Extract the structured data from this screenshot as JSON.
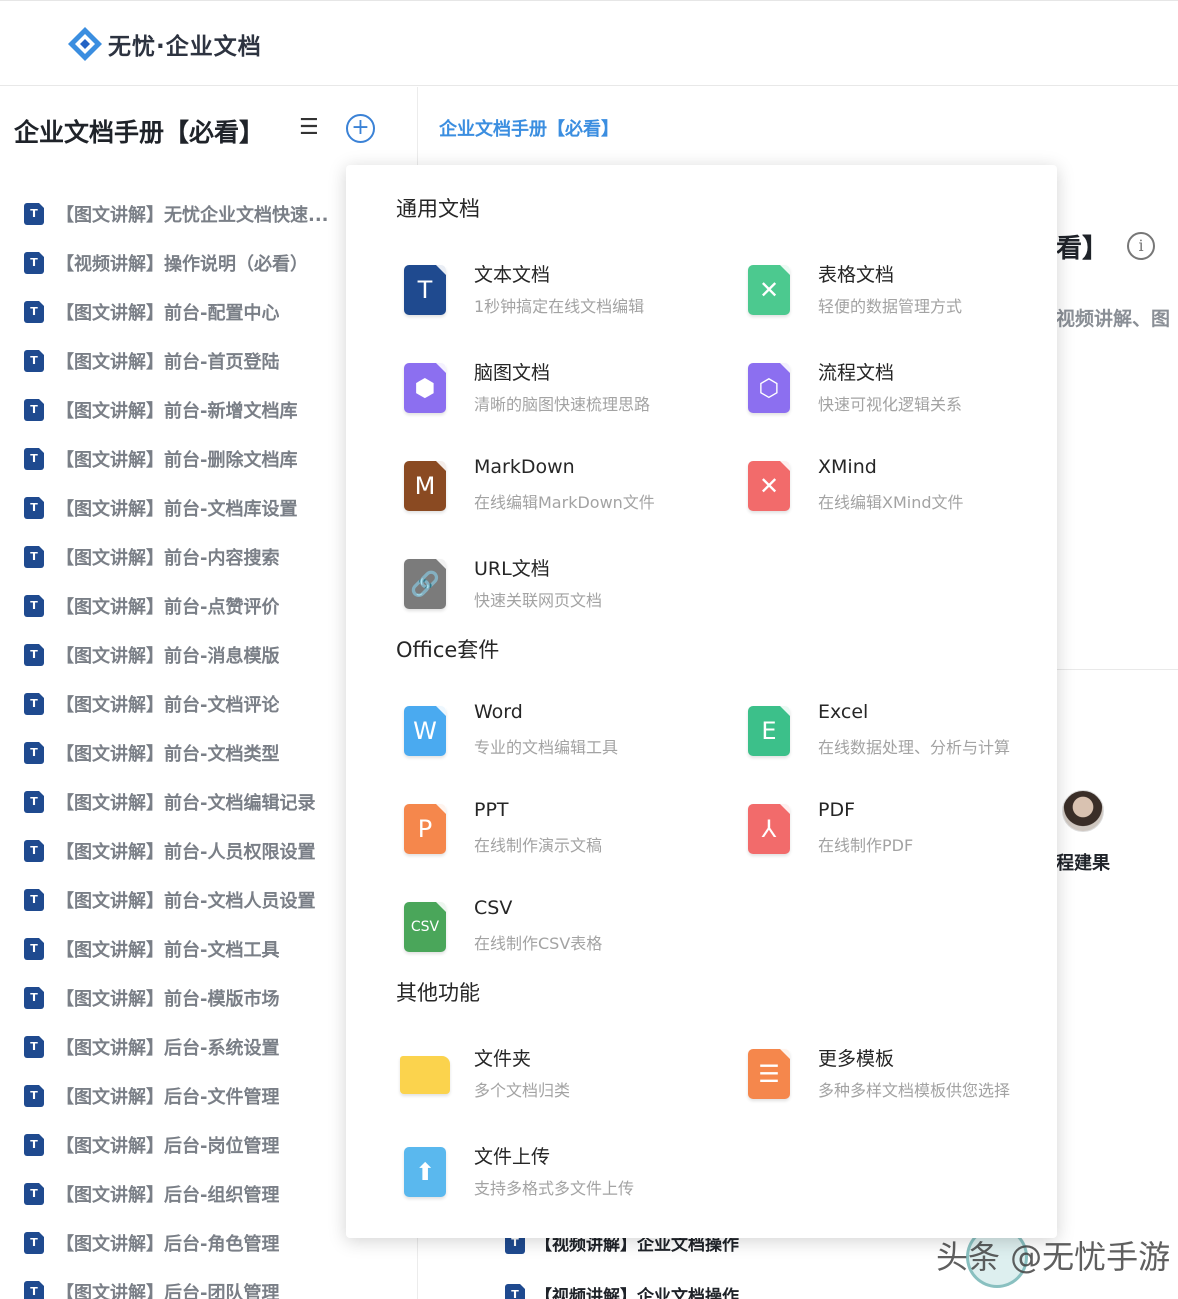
{
  "app": {
    "brand": "无忧·企业文档"
  },
  "sidebar": {
    "title": "企业文档手册【必看】",
    "menu_glyph": "☰",
    "add_glyph": "+",
    "items": [
      "【图文讲解】无忧企业文档快速...",
      "【视频讲解】操作说明（必看）",
      "【图文讲解】前台-配置中心",
      "【图文讲解】前台-首页登陆",
      "【图文讲解】前台-新增文档库",
      "【图文讲解】前台-删除文档库",
      "【图文讲解】前台-文档库设置",
      "【图文讲解】前台-内容搜索",
      "【图文讲解】前台-点赞评价",
      "【图文讲解】前台-消息模版",
      "【图文讲解】前台-文档评论",
      "【图文讲解】前台-文档类型",
      "【图文讲解】前台-文档编辑记录",
      "【图文讲解】前台-人员权限设置",
      "【图文讲解】前台-文档人员设置",
      "【图文讲解】前台-文档工具",
      "【图文讲解】前台-模版市场",
      "【图文讲解】后台-系统设置",
      "【图文讲解】后台-文件管理",
      "【图文讲解】后台-岗位管理",
      "【图文讲解】后台-组织管理",
      "【图文讲解】后台-角色管理",
      "【图文讲解】后台-团队管理"
    ],
    "item_icon_letter": "T"
  },
  "main": {
    "breadcrumb": "企业文档手册【必看】",
    "title_fragment": "看】",
    "info_glyph": "i",
    "subtitle_fragment": "视频讲解、图",
    "author": "程建果",
    "rows": [
      "【视频讲解】企业文档操作",
      "【视频讲解】企业文档操作"
    ]
  },
  "popup": {
    "sections": [
      {
        "title": "通用文档",
        "items": [
          {
            "name": "文本文档",
            "desc": "1秒钟搞定在线文档编辑",
            "icon": "text-doc-icon",
            "glyph": "T",
            "color": "#1f4a8f"
          },
          {
            "name": "表格文档",
            "desc": "轻便的数据管理方式",
            "icon": "sheet-doc-icon",
            "glyph": "✕",
            "color": "#4cc98f"
          },
          {
            "name": "脑图文档",
            "desc": "清晰的脑图快速梳理思路",
            "icon": "mindmap-doc-icon",
            "glyph": "⬢",
            "color": "#8c6ff0"
          },
          {
            "name": "流程文档",
            "desc": "快速可视化逻辑关系",
            "icon": "flow-doc-icon",
            "glyph": "⬡",
            "color": "#8c6ff0"
          },
          {
            "name": "MarkDown",
            "desc": "在线编辑MarkDown文件",
            "icon": "markdown-doc-icon",
            "glyph": "M",
            "color": "#8a4a22"
          },
          {
            "name": "XMind",
            "desc": "在线编辑XMind文件",
            "icon": "xmind-doc-icon",
            "glyph": "✕",
            "color": "#f26b6b"
          },
          {
            "name": "URL文档",
            "desc": "快速关联网页文档",
            "icon": "link-doc-icon",
            "glyph": "🔗",
            "color": "#7b7b7b"
          }
        ]
      },
      {
        "title": "Office套件",
        "items": [
          {
            "name": "Word",
            "desc": "专业的文档编辑工具",
            "icon": "word-doc-icon",
            "glyph": "W",
            "color": "#4aaaf0"
          },
          {
            "name": "Excel",
            "desc": "在线数据处理、分析与计算",
            "icon": "excel-doc-icon",
            "glyph": "E",
            "color": "#3cc08a"
          },
          {
            "name": "PPT",
            "desc": "在线制作演示文稿",
            "icon": "ppt-doc-icon",
            "glyph": "P",
            "color": "#f5874c"
          },
          {
            "name": "PDF",
            "desc": "在线制作PDF",
            "icon": "pdf-doc-icon",
            "glyph": "⅄",
            "color": "#f26b6b"
          },
          {
            "name": "CSV",
            "desc": "在线制作CSV表格",
            "icon": "csv-doc-icon",
            "glyph": "CSV",
            "color": "#4aa65a"
          }
        ]
      },
      {
        "title": "其他功能",
        "items": [
          {
            "name": "文件夹",
            "desc": "多个文档归类",
            "icon": "folder-icon",
            "glyph": "",
            "color": "#fbd34d"
          },
          {
            "name": "更多模板",
            "desc": "多种多样文档模板供您选择",
            "icon": "template-icon",
            "glyph": "☰",
            "color": "#f5874c"
          },
          {
            "name": "文件上传",
            "desc": "支持多格式多文件上传",
            "icon": "upload-icon",
            "glyph": "⬆",
            "color": "#5ab8ee"
          }
        ]
      }
    ]
  },
  "watermark": "头条 @无忧手游"
}
